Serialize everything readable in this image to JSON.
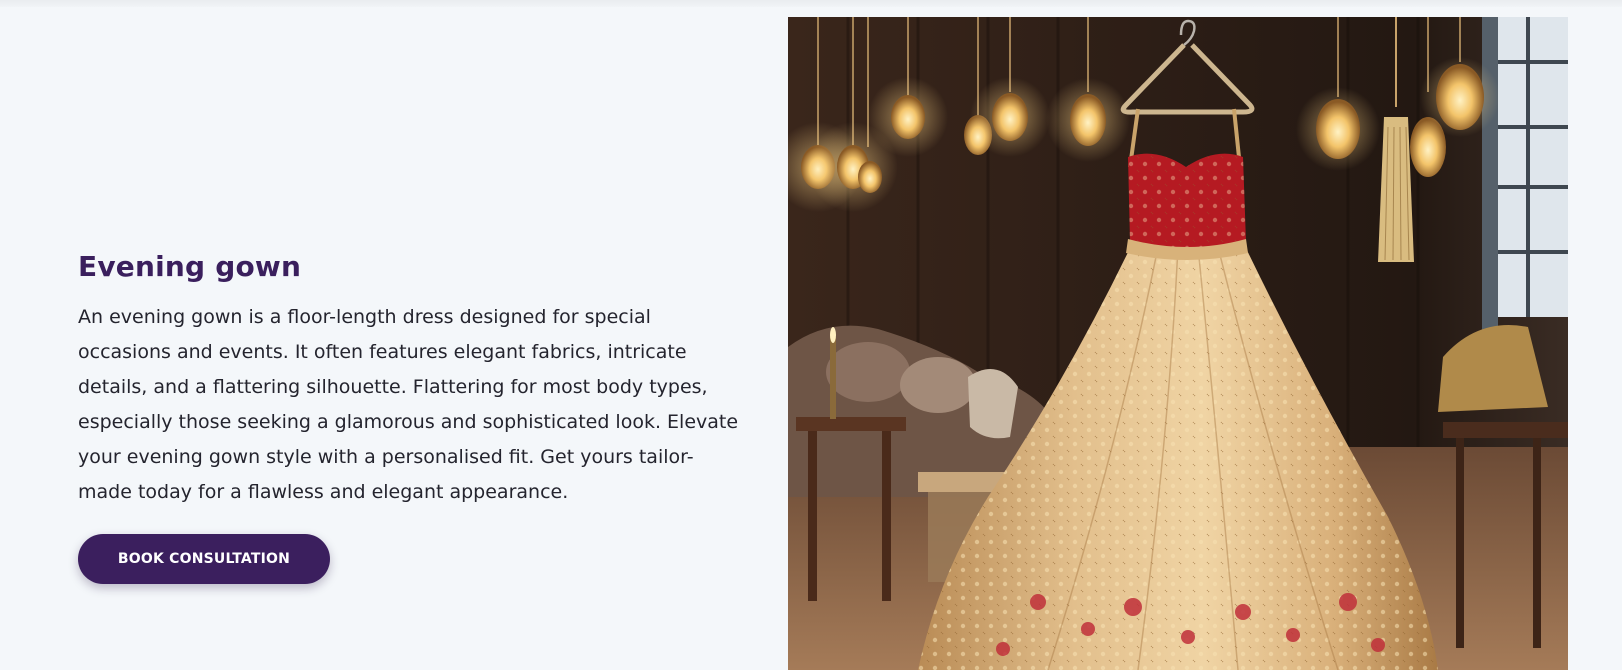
{
  "section": {
    "title": "Evening gown",
    "description": "An evening gown is a floor-length dress designed for special occasions and events. It often features elegant fabrics, intricate details, and a flattering silhouette. Flattering for most body types, especially those seeking a glamorous and sophisticated look. Elevate your evening gown style with a personalised fit. Get yours tailor-made today for a flawless and elegant appearance.",
    "cta_label": "BOOK CONSULTATION"
  },
  "image": {
    "subject": "embroidered-evening-gown-on-hanger",
    "colors": {
      "room_dark": "#2a1b14",
      "room_mid": "#4a3022",
      "gown_gold": "#d8b27a",
      "bodice_red": "#b51a22",
      "bulb_glow": "#f3c46a",
      "window": "#dfe6ec"
    }
  },
  "theme": {
    "accent": "#3b1f5e",
    "background": "#f4f7fa",
    "text": "#24242e"
  }
}
